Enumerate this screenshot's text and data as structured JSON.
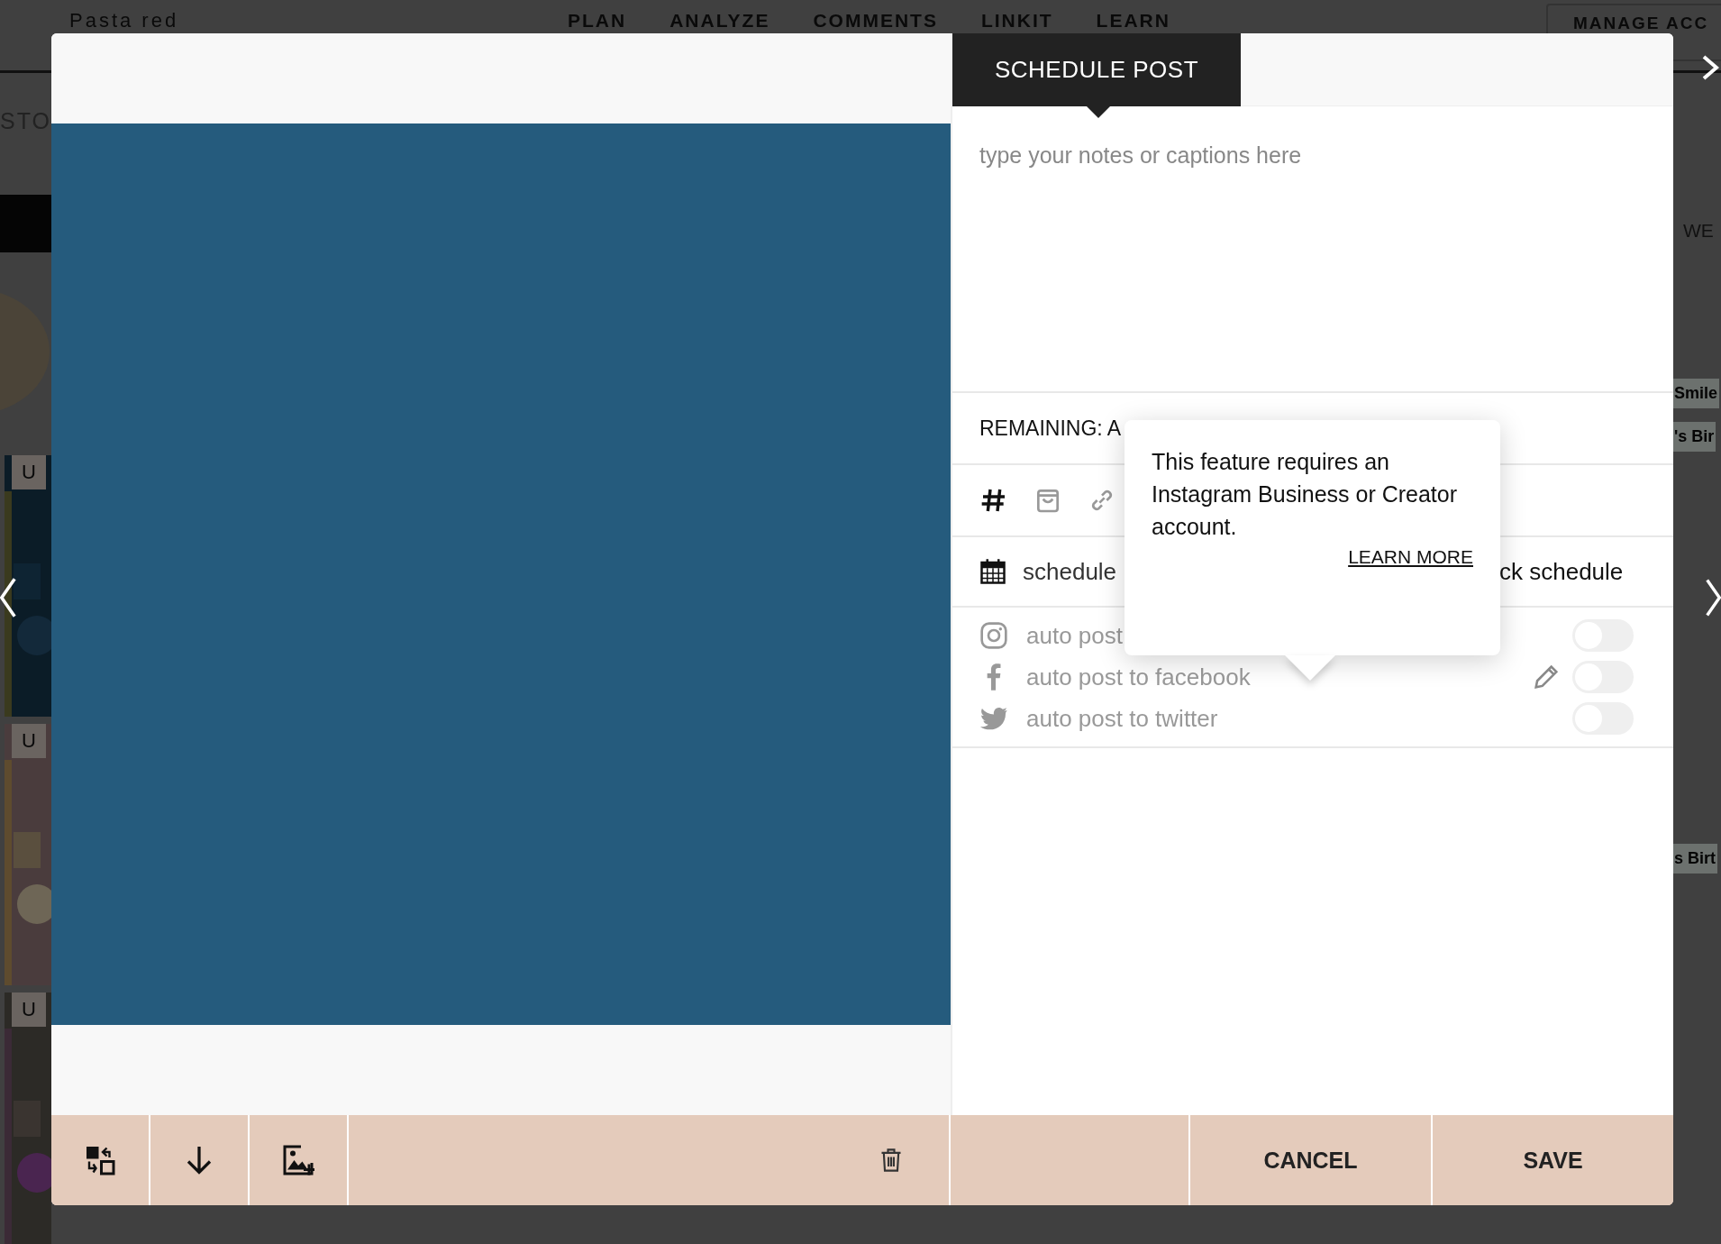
{
  "background": {
    "account": "Pasta red",
    "nav": [
      "PLAN",
      "ANALYZE",
      "COMMENTS",
      "LINKIT",
      "LEARN"
    ],
    "manage_button": "MANAGE ACC",
    "left_tab": "STO",
    "grid_tiles": [
      {
        "badge": "U"
      },
      {
        "badge": "U"
      },
      {
        "badge": "U"
      }
    ],
    "calendar_fragments": [
      "WE",
      "Smile",
      "'s Bir",
      "s Birt"
    ]
  },
  "modal": {
    "tab": {
      "label": "SCHEDULE POST",
      "selected": true
    },
    "caption": {
      "placeholder": "type your notes or captions here"
    },
    "remaining": "REMAINING: A",
    "schedule_left": "schedule",
    "schedule_right": "ck schedule",
    "autopost": [
      {
        "kind": "instagram",
        "label": "auto post",
        "on": false,
        "editable": false
      },
      {
        "kind": "facebook",
        "label": "auto post to facebook",
        "on": false,
        "editable": true
      },
      {
        "kind": "twitter",
        "label": "auto post to twitter",
        "on": false,
        "editable": false
      }
    ],
    "tooltip": {
      "text": "This feature requires an Instagram Business or Creator account.",
      "link": "LEARN MORE"
    },
    "buttons": [
      "CANCEL",
      "SAVE"
    ]
  }
}
